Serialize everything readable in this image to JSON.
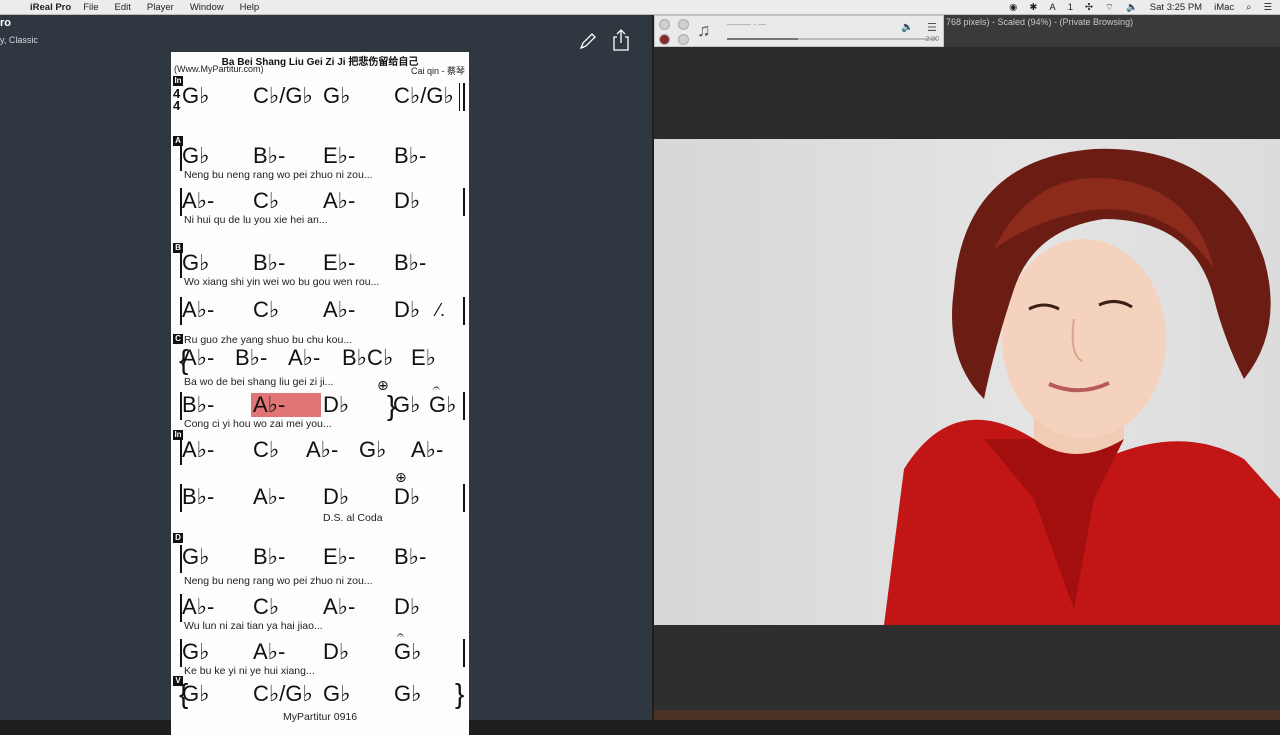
{
  "menubar": {
    "app_name": "iReal Pro",
    "items": [
      "File",
      "Edit",
      "Player",
      "Window",
      "Help"
    ],
    "clock": "Sat 3:25 PM",
    "user": "iMac",
    "battery_text": "1"
  },
  "ireal": {
    "title": "ro",
    "subtitle": "y, Classic"
  },
  "chart": {
    "song_title": "Ba Bei Shang Liu Gei Zi Ji 把悲伤留给自己",
    "website": "(Www.MyPartitur.com)",
    "composer": "Cai qin - 蔡琴",
    "time_signature_top": "4",
    "time_signature_bottom": "4",
    "sections": {
      "intro": "In",
      "a": "A",
      "b": "B",
      "c": "C",
      "d": "D",
      "v": "V",
      "in2": "In"
    },
    "lyrics": [
      "Neng bu neng rang wo pei zhuo ni zou...",
      "Ni hui qu de lu you xie hei an...",
      "Wo xiang shi yin wei wo bu gou wen rou...",
      "Ru guo zhe yang shuo bu chu kou...",
      "Ba wo de bei shang liu gei zi ji...",
      "Cong ci yi hou wo zai mei you...",
      "Neng bu neng rang wo pei zhuo ni zou...",
      "Wu lun ni zai tian ya hai jiao...",
      "Ke bu ke yi ni ye hui xiang..."
    ],
    "ds_al_coda": "D.S. al Coda",
    "footer": "MyPartitur 0916",
    "rows": [
      [
        "G♭",
        "C♭/G♭",
        "G♭",
        "C♭/G♭"
      ],
      [
        "G♭",
        "B♭-",
        "E♭-",
        "B♭-"
      ],
      [
        "A♭-",
        "C♭",
        "A♭-",
        "D♭"
      ],
      [
        "G♭",
        "B♭-",
        "E♭-",
        "B♭-"
      ],
      [
        "A♭-",
        "C♭",
        "A♭-",
        "D♭"
      ],
      [
        "A♭-",
        "B♭-",
        "A♭-",
        "B♭C♭",
        "E♭"
      ],
      [
        "B♭-",
        "A♭-",
        "D♭",
        "G♭",
        "G♭"
      ],
      [
        "A♭-",
        "C♭",
        "A♭-",
        "G♭",
        "A♭-"
      ],
      [
        "B♭-",
        "A♭-",
        "D♭",
        "D♭"
      ],
      [
        "G♭",
        "B♭-",
        "E♭-",
        "B♭-"
      ],
      [
        "A♭-",
        "C♭",
        "A♭-",
        "D♭"
      ],
      [
        "G♭",
        "A♭-",
        "D♭",
        "G♭"
      ],
      [
        "G♭",
        "C♭/G♭",
        "G♭",
        "G♭"
      ]
    ]
  },
  "player": {
    "track": "——— - —",
    "time": "2:00",
    "progress": 0.34
  },
  "browser": {
    "title": "768 pixels) - Scaled (94%) - (Private Browsing)"
  }
}
